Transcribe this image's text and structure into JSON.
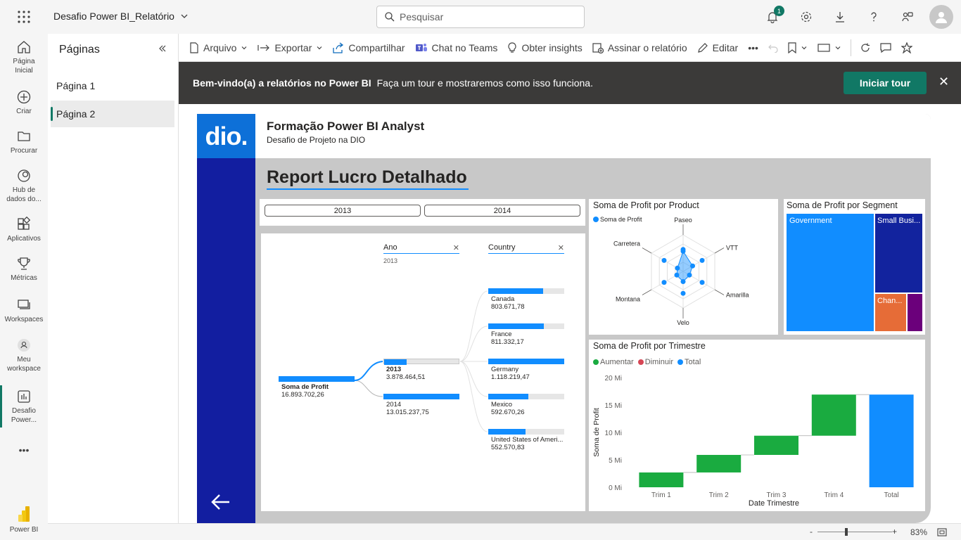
{
  "app": {
    "title": "Desafio Power BI_Relatório",
    "search_placeholder": "Pesquisar",
    "notifications_count": "1"
  },
  "leftnav": {
    "items": [
      {
        "label1": "Página",
        "label2": "Inicial"
      },
      {
        "label1": "Criar",
        "label2": ""
      },
      {
        "label1": "Procurar",
        "label2": ""
      },
      {
        "label1": "Hub de",
        "label2": "dados do..."
      },
      {
        "label1": "Aplicativos",
        "label2": ""
      },
      {
        "label1": "Métricas",
        "label2": ""
      },
      {
        "label1": "Workspaces",
        "label2": ""
      },
      {
        "label1": "Meu",
        "label2": "workspace"
      },
      {
        "label1": "Desafio",
        "label2": "Power..."
      }
    ],
    "more": "•••",
    "brand": "Power BI"
  },
  "pages_pane": {
    "title": "Páginas",
    "items": [
      "Página 1",
      "Página 2"
    ],
    "active_index": 1
  },
  "toolbar": {
    "file": "Arquivo",
    "export": "Exportar",
    "share": "Compartilhar",
    "teams": "Chat no Teams",
    "insights": "Obter insights",
    "subscribe": "Assinar o relatório",
    "edit": "Editar",
    "more": "•••"
  },
  "banner": {
    "bold": "Bem-vindo(a) a relatórios no Power BI",
    "text": "Faça um tour e mostraremos como isso funciona.",
    "button": "Iniciar tour",
    "close": "✕"
  },
  "report": {
    "logo": "dio.",
    "header_title": "Formação Power BI Analyst",
    "header_subtitle": "Desafio de Projeto na DIO",
    "title": "Report Lucro Detalhado",
    "slicer_values": [
      "2013",
      "2014"
    ]
  },
  "decomp_tree": {
    "level1_header": "Ano",
    "level1_sub": "2013",
    "level2_header": "Country",
    "root": {
      "label": "Soma de Profit",
      "value": "16.893.702,26",
      "fill": 1.0
    },
    "years": [
      {
        "label": "2013",
        "value": "3.878.464,51",
        "fill": 0.3
      },
      {
        "label": "2014",
        "value": "13.015.237,75",
        "fill": 1.0
      }
    ],
    "countries": [
      {
        "label": "Canada",
        "value": "803.671,78",
        "fill": 0.72
      },
      {
        "label": "France",
        "value": "811.332,17",
        "fill": 0.73
      },
      {
        "label": "Germany",
        "value": "1.118.219,47",
        "fill": 1.0
      },
      {
        "label": "Mexico",
        "value": "592.670,26",
        "fill": 0.53
      },
      {
        "label": "United States of Ameri...",
        "value": "552.570,83",
        "fill": 0.49
      }
    ]
  },
  "radar": {
    "title": "Soma de Profit por Product",
    "legend": "Soma de Profit",
    "axes": [
      "Paseo",
      "VTT",
      "Amarilla",
      "Velo",
      "Montana",
      "Carretera"
    ],
    "values": [
      0.55,
      0.3,
      0.2,
      0.28,
      0.2,
      0.18
    ]
  },
  "treemap": {
    "title": "Soma de Profit por Segment",
    "tiles": [
      {
        "label": "Government",
        "color": "#118dff"
      },
      {
        "label": "Small Busi...",
        "color": "#12239e"
      },
      {
        "label": "Chan...",
        "color": "#e66c37"
      },
      {
        "label": "",
        "color": "#6b007b"
      }
    ]
  },
  "chart_data": {
    "type": "bar",
    "title": "Soma de Profit por Trimestre",
    "xlabel": "Date Trimestre",
    "ylabel": "Soma de Profit",
    "categories": [
      "Trim 1",
      "Trim 2",
      "Trim 3",
      "Trim 4",
      "Total"
    ],
    "ylim": [
      0,
      20
    ],
    "yticks": [
      "0 Mi",
      "5 Mi",
      "10 Mi",
      "15 Mi",
      "20 Mi"
    ],
    "legend": [
      "Aumentar",
      "Diminuir",
      "Total"
    ],
    "colors": {
      "Aumentar": "#1aab40",
      "Diminuir": "#d64554",
      "Total": "#118dff"
    },
    "waterfall": [
      {
        "category": "Trim 1",
        "start": 0,
        "end": 2.7,
        "kind": "Aumentar"
      },
      {
        "category": "Trim 2",
        "start": 2.7,
        "end": 5.9,
        "kind": "Aumentar"
      },
      {
        "category": "Trim 3",
        "start": 5.9,
        "end": 9.4,
        "kind": "Aumentar"
      },
      {
        "category": "Trim 4",
        "start": 9.4,
        "end": 16.9,
        "kind": "Aumentar"
      },
      {
        "category": "Total",
        "start": 0,
        "end": 16.9,
        "kind": "Total"
      }
    ],
    "grid": false
  },
  "statusbar": {
    "zoom": "83%",
    "minus": "-",
    "plus": "+"
  }
}
